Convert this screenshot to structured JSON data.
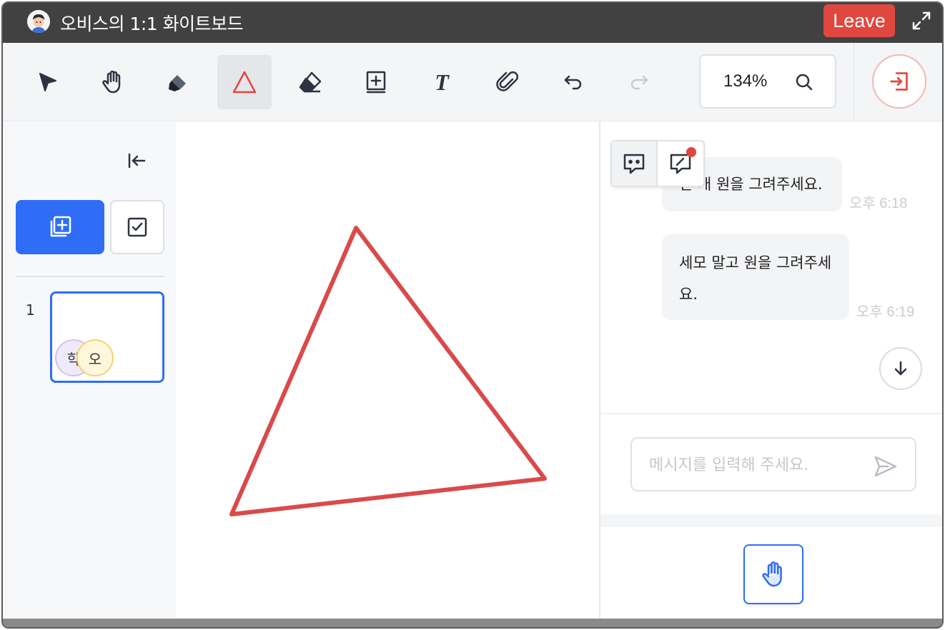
{
  "window": {
    "title": "오비스의 1:1 화이트보드",
    "leave_label": "Leave"
  },
  "toolbar": {
    "tools": [
      {
        "name": "select",
        "icon": "cursor-arrow-icon",
        "active": false
      },
      {
        "name": "pan",
        "icon": "hand-icon",
        "active": false
      },
      {
        "name": "highlighter",
        "icon": "marker-icon",
        "active": false
      },
      {
        "name": "shape",
        "icon": "triangle-icon",
        "active": true
      },
      {
        "name": "eraser",
        "icon": "eraser-icon",
        "active": false
      },
      {
        "name": "add-box",
        "icon": "plus-square-icon",
        "active": false
      },
      {
        "name": "text",
        "icon": "text-t-icon",
        "active": false
      },
      {
        "name": "attach",
        "icon": "paperclip-icon",
        "active": false
      },
      {
        "name": "undo",
        "icon": "undo-icon",
        "active": false
      },
      {
        "name": "redo",
        "icon": "redo-icon",
        "active": false,
        "disabled": true
      }
    ],
    "zoom": "134%"
  },
  "sidebar": {
    "pages": [
      {
        "number": "1",
        "participants": [
          "학",
          "오"
        ]
      }
    ]
  },
  "chat": {
    "messages": [
      {
        "text": "한 개 원을 그려주세요.",
        "time": "오후 6:18"
      },
      {
        "text": "세모 말고 원을 그려주세요.",
        "time": "오후 6:19"
      }
    ],
    "input_placeholder": "메시지를 입력해 주세요."
  },
  "colors": {
    "accent": "#2f6df6",
    "danger": "#e0473e",
    "stroke": "#d94a4a",
    "titlebar": "#414141"
  }
}
